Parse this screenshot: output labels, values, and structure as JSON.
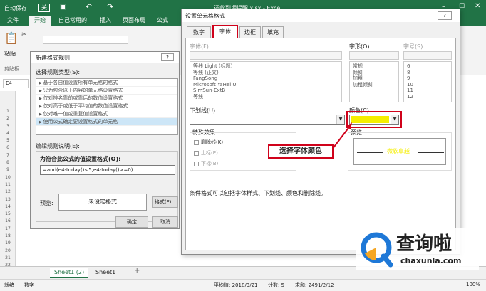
{
  "excel": {
    "qa_autosave": "自动保存",
    "qa_off": "关",
    "title": "还款到期提醒.xlsx - Excel",
    "ribbon_tabs": [
      "文件",
      "开始",
      "自己常用的",
      "插入",
      "页面布局",
      "公式"
    ],
    "paste_label": "粘贴",
    "clipboard_group": "剪贴板",
    "name_box": "E4",
    "rows": [
      "1",
      "2",
      "3",
      "4",
      "5",
      "6",
      "7",
      "8",
      "9",
      "10",
      "11",
      "12",
      "13",
      "14",
      "15",
      "16",
      "17",
      "18",
      "19",
      "20",
      "21",
      "22"
    ],
    "sheet_tabs": [
      "Sheet1 (2)",
      "Sheet1"
    ],
    "add_sheet": "+",
    "status_ready": "就绪",
    "status_numlock": "数字",
    "status_avg": "平均值: 2018/3/21",
    "status_count": "计数: 5",
    "status_sum": "求和: 2491/2/12",
    "zoom": "100%"
  },
  "rule_dialog": {
    "title": "新建格式规则",
    "help": "?",
    "select_type_label": "选择规则类型(S):",
    "rule_types": [
      "基于各自值设置所有单元格的格式",
      "只为包含以下内容的单元格设置格式",
      "仅对排名靠前或靠后的数值设置格式",
      "仅对高于或低于平均值的数值设置格式",
      "仅对唯一值或重复值设置格式",
      "使用公式确定要设置格式的单元格"
    ],
    "edit_label": "编辑规则说明(E):",
    "formula_label": "为符合此公式的值设置格式(O):",
    "formula": "=and(e4-today()<5,e4-today()>=0)",
    "preview_label": "预览:",
    "preview_text": "未设定格式",
    "format_button": "格式(F)...",
    "ok": "确定",
    "cancel": "取消"
  },
  "cell_dialog": {
    "title": "设置单元格格式",
    "help": "?",
    "tabs": [
      "数字",
      "字体",
      "边框",
      "填充"
    ],
    "font_label": "字体(F):",
    "fonts": [
      "等线 Light (标题)",
      "等线 (正文)",
      "FangSong",
      "Microsoft YaHei UI",
      "SimSun-ExtB",
      "等线"
    ],
    "style_label": "字形(O):",
    "styles": [
      "常规",
      "倾斜",
      "加粗",
      "加粗倾斜"
    ],
    "size_label": "字号(S):",
    "sizes": [
      "6",
      "8",
      "9",
      "10",
      "11",
      "12"
    ],
    "underline_label": "下划线(U):",
    "color_label": "颜色(C):",
    "color_value": "#f5ee00",
    "effects_label": "特殊效果",
    "effects": [
      "删除线(K)",
      "上标(E)",
      "下标(B)"
    ],
    "preview_label": "预览",
    "preview_text": "微软卓越",
    "note": "条件格式可以包括字体样式、下划线、颜色和删除线。"
  },
  "annotation": {
    "text": "选择字体颜色",
    "color": "#d0021b"
  },
  "watermark": {
    "site": "查询啦",
    "url": "chaxunla.com"
  }
}
